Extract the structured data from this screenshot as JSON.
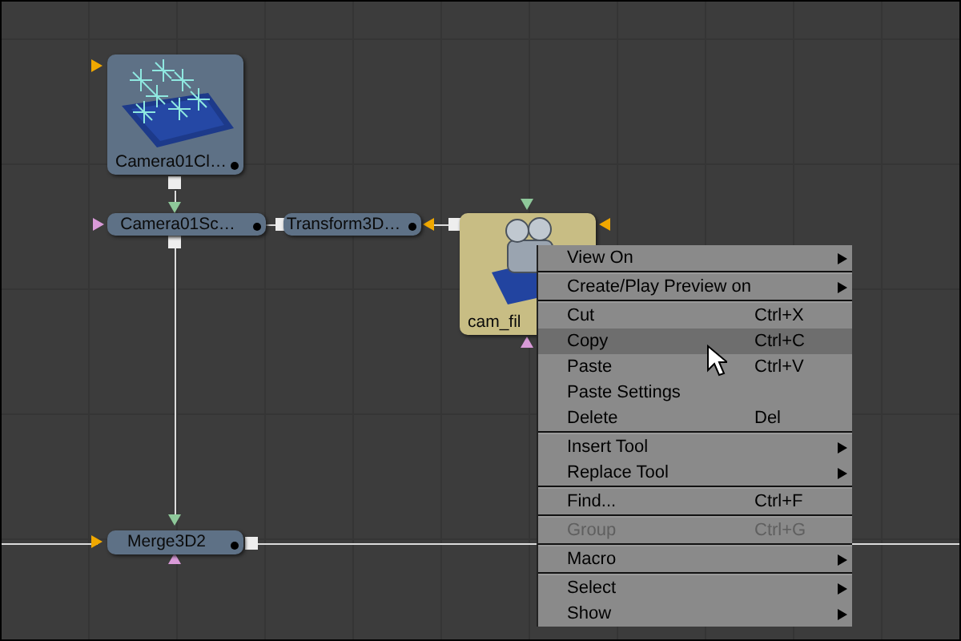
{
  "nodes": [
    {
      "label": "Camera01Cl…",
      "kind": "grid-render",
      "color": "#5e7186"
    },
    {
      "label": "Camera01Sc…",
      "kind": "bar",
      "color": "#5e7186"
    },
    {
      "label": "Transform3D…",
      "kind": "bar",
      "color": "#5e7186"
    },
    {
      "label": "cam_fil",
      "kind": "camera-render",
      "color": "#c8bd84"
    },
    {
      "label": "Merge3D2",
      "kind": "bar",
      "color": "#5e7186"
    }
  ],
  "context_menu": {
    "sections": [
      [
        {
          "label": "View On",
          "submenu": true,
          "disabled": false,
          "selected": false
        }
      ],
      [
        {
          "label": "Create/Play Preview on",
          "submenu": true,
          "disabled": false,
          "selected": false
        }
      ],
      [
        {
          "label": "Cut",
          "shortcut": "Ctrl+X",
          "submenu": false,
          "disabled": false,
          "selected": false
        },
        {
          "label": "Copy",
          "shortcut": "Ctrl+C",
          "submenu": false,
          "disabled": false,
          "selected": true
        },
        {
          "label": "Paste",
          "shortcut": "Ctrl+V",
          "submenu": false,
          "disabled": false,
          "selected": false
        },
        {
          "label": "Paste Settings",
          "submenu": false,
          "disabled": false,
          "selected": false
        },
        {
          "label": "Delete",
          "shortcut": "Del",
          "submenu": false,
          "disabled": false,
          "selected": false
        }
      ],
      [
        {
          "label": "Insert Tool",
          "submenu": true,
          "disabled": false,
          "selected": false
        },
        {
          "label": "Replace Tool",
          "submenu": true,
          "disabled": false,
          "selected": false
        }
      ],
      [
        {
          "label": "Find...",
          "shortcut": "Ctrl+F",
          "submenu": false,
          "disabled": false,
          "selected": false
        }
      ],
      [
        {
          "label": "Group",
          "shortcut": "Ctrl+G",
          "submenu": false,
          "disabled": true,
          "selected": false
        }
      ],
      [
        {
          "label": "Macro",
          "submenu": true,
          "disabled": false,
          "selected": false
        }
      ],
      [
        {
          "label": "Select",
          "submenu": true,
          "disabled": false,
          "selected": false
        },
        {
          "label": "Show",
          "submenu": true,
          "disabled": false,
          "selected": false
        }
      ]
    ]
  }
}
